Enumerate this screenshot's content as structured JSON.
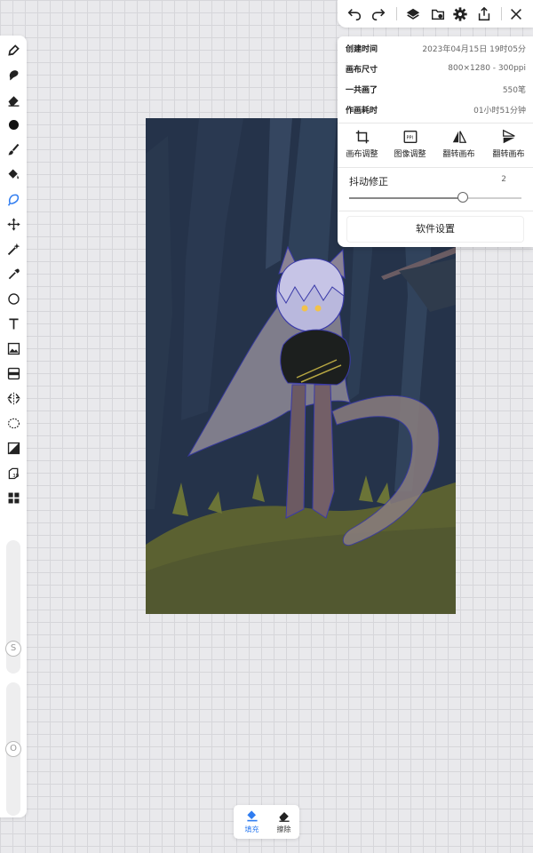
{
  "toolbar": {
    "tools": [
      {
        "name": "pen-tool-icon",
        "active": false
      },
      {
        "name": "smudge-tool-icon",
        "active": false
      },
      {
        "name": "eraser-tool-icon",
        "active": false
      },
      {
        "name": "color-swatch-icon",
        "active": false
      },
      {
        "name": "brush-tool-icon",
        "active": false
      },
      {
        "name": "paint-bucket-icon",
        "active": false
      },
      {
        "name": "lasso-fill-icon",
        "active": true
      },
      {
        "name": "move-tool-icon",
        "active": false
      },
      {
        "name": "magic-wand-icon",
        "active": false
      },
      {
        "name": "eyedropper-icon",
        "active": false
      },
      {
        "name": "shape-circle-icon",
        "active": false
      },
      {
        "name": "text-tool-icon",
        "active": false
      },
      {
        "name": "image-import-icon",
        "active": false
      },
      {
        "name": "filter-icon",
        "active": false
      },
      {
        "name": "symmetry-icon",
        "active": false
      },
      {
        "name": "selection-icon",
        "active": false
      },
      {
        "name": "adjust-image-icon",
        "active": false
      },
      {
        "name": "3d-layer-icon",
        "active": false
      },
      {
        "name": "more-tools-icon",
        "active": false
      }
    ],
    "size_slider_label": "S",
    "opacity_slider_label": "O",
    "active_color": "#2f7cf0"
  },
  "topbar": {
    "buttons": [
      "undo-icon",
      "redo-icon",
      "layers-icon",
      "gallery-icon",
      "settings-gear-icon",
      "export-icon",
      "close-icon"
    ]
  },
  "panel": {
    "info": [
      {
        "label": "创建时间",
        "value": "2023年04月15日 19时05分"
      },
      {
        "label": "画布尺寸",
        "value": "800×1280 - 300ppi"
      },
      {
        "label": "一共画了",
        "value": "550笔"
      },
      {
        "label": "作画耗时",
        "value": "01小时51分钟"
      }
    ],
    "actions": [
      {
        "label": "画布调整",
        "icon": "crop-icon"
      },
      {
        "label": "图像调整",
        "icon": "ppi-icon"
      },
      {
        "label": "翻转画布",
        "icon": "flip-horizontal-icon"
      },
      {
        "label": "翻转画布",
        "icon": "flip-vertical-icon"
      }
    ],
    "stabilizer": {
      "label": "抖动修正",
      "value": "2",
      "fraction": 0.66
    },
    "settings_label": "软件设置"
  },
  "bottom": {
    "fill_label": "填充",
    "erase_label": "擦除",
    "active": "fill"
  }
}
